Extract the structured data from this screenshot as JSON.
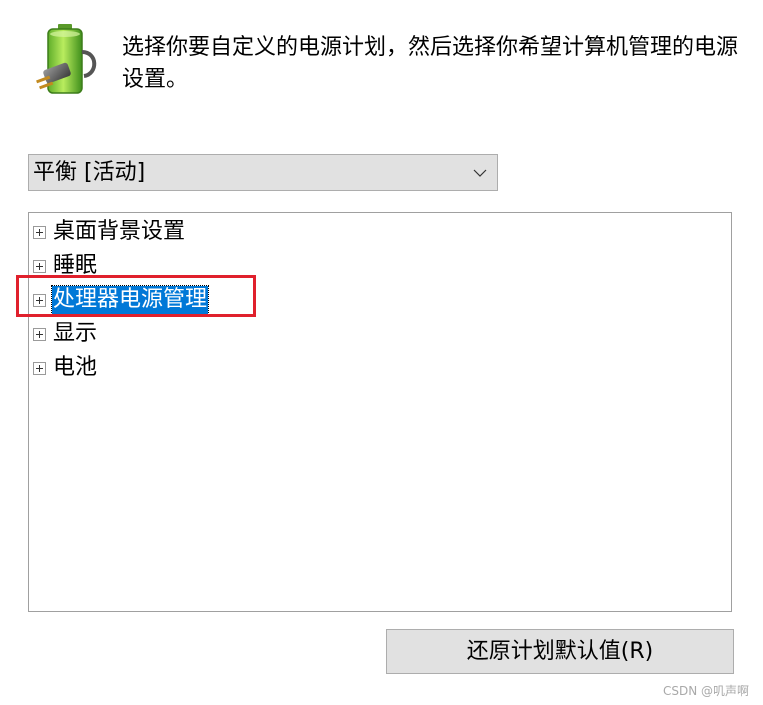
{
  "header": {
    "icon": "power-plug-battery-icon",
    "description": "选择你要自定义的电源计划，然后选择你希望计算机管理的电源设置。"
  },
  "plan_selector": {
    "selected_value": "平衡 [活动]",
    "chevron_icon": "chevron-down-icon"
  },
  "settings_tree": {
    "items": [
      {
        "label": "桌面背景设置",
        "selected": false
      },
      {
        "label": "睡眠",
        "selected": false
      },
      {
        "label": "处理器电源管理",
        "selected": true
      },
      {
        "label": "显示",
        "selected": false
      },
      {
        "label": "电池",
        "selected": false
      }
    ],
    "highlight_color": "#e0202c",
    "selection_color": "#0078d7"
  },
  "actions": {
    "restore_label": "还原计划默认值(R)"
  },
  "watermark": {
    "text": "CSDN @叽声啊"
  }
}
